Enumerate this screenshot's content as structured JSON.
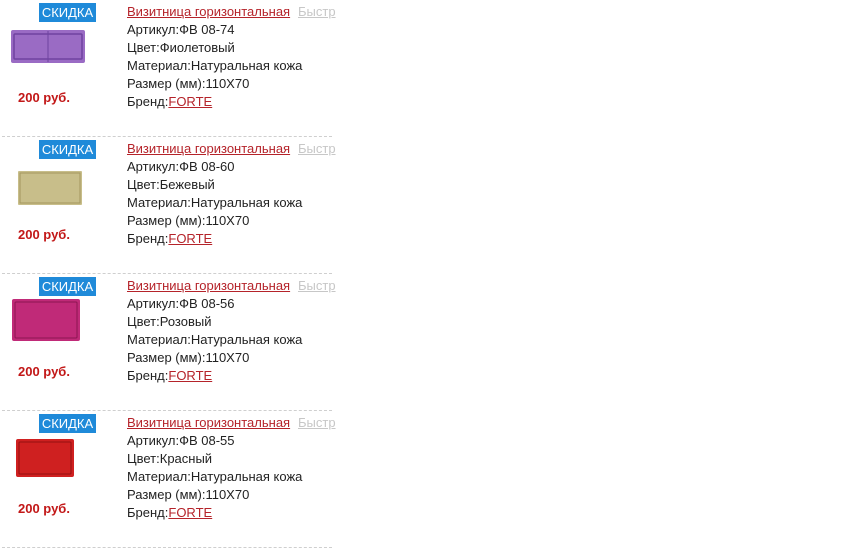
{
  "products": [
    {
      "badge": "СКИДКА",
      "title": "Визитница горизонтальная",
      "quick_view": "Быстр",
      "price": "200 руб.",
      "article_label": "Артикул:",
      "article": "ФВ 08-74",
      "color_label": "Цвет:",
      "color": "Фиолетовый",
      "material_label": "Материал:",
      "material": "Натуральная кожа",
      "size_label": "Размер (мм):",
      "size": "110Х70",
      "brand_label": "Бренд:",
      "brand": "FORTE",
      "swatch": "#9a6bc4",
      "swatch_dark": "#6f43a0"
    },
    {
      "badge": "СКИДКА",
      "title": "Визитница горизонтальная",
      "quick_view": "Быстр",
      "price": "200 руб.",
      "article_label": "Артикул:",
      "article": "ФВ 08-60",
      "color_label": "Цвет:",
      "color": "Бежевый",
      "material_label": "Материал:",
      "material": "Натуральная кожа",
      "size_label": "Размер (мм):",
      "size": "110Х70",
      "brand_label": "Бренд:",
      "brand": "FORTE",
      "swatch": "#c8be8a",
      "swatch_dark": "#a3975f"
    },
    {
      "badge": "СКИДКА",
      "title": "Визитница горизонтальная",
      "quick_view": "Быстр",
      "price": "200 руб.",
      "article_label": "Артикул:",
      "article": "ФВ 08-56",
      "color_label": "Цвет:",
      "color": "Розовый",
      "material_label": "Материал:",
      "material": "Натуральная кожа",
      "size_label": "Размер (мм):",
      "size": "110Х70",
      "brand_label": "Бренд:",
      "brand": "FORTE",
      "swatch": "#c02a78",
      "swatch_dark": "#8c1552"
    },
    {
      "badge": "СКИДКА",
      "title": "Визитница горизонтальная",
      "quick_view": "Быстр",
      "price": "200 руб.",
      "article_label": "Артикул:",
      "article": "ФВ 08-55",
      "color_label": "Цвет:",
      "color": "Красный",
      "material_label": "Материал:",
      "material": "Натуральная кожа",
      "size_label": "Размер (мм):",
      "size": "110Х70",
      "brand_label": "Бренд:",
      "brand": "FORTE",
      "swatch": "#cf2020",
      "swatch_dark": "#961010"
    }
  ]
}
